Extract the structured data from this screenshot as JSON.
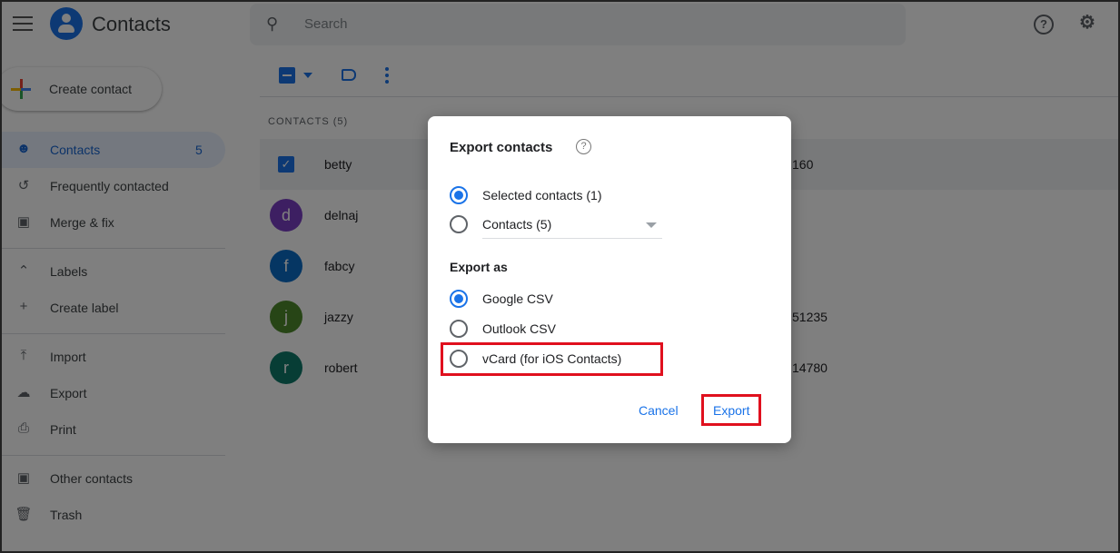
{
  "header": {
    "app_title": "Contacts",
    "search_placeholder": "Search",
    "help_icon": "?",
    "settings_icon": "⚙"
  },
  "sidebar": {
    "create_label": "Create contact",
    "items": [
      {
        "label": "Contacts",
        "count": "5",
        "icon": "person"
      },
      {
        "label": "Frequently contacted",
        "icon": "history"
      },
      {
        "label": "Merge & fix",
        "icon": "merge"
      },
      {
        "label": "Labels",
        "icon": "chevron-up"
      },
      {
        "label": "Create label",
        "icon": "plus"
      },
      {
        "label": "Import",
        "icon": "upload"
      },
      {
        "label": "Export",
        "icon": "cloud-download"
      },
      {
        "label": "Print",
        "icon": "printer"
      },
      {
        "label": "Other contacts",
        "icon": "archive"
      },
      {
        "label": "Trash",
        "icon": "trash"
      }
    ]
  },
  "list": {
    "header": "CONTACTS (5)",
    "rows": [
      {
        "name": "betty",
        "initial": "",
        "phone": "160",
        "color": "#1a73e8"
      },
      {
        "name": "delnaj",
        "initial": "d",
        "phone": "",
        "color": "#7b3fc4"
      },
      {
        "name": "fabcy",
        "initial": "f",
        "phone": "",
        "color": "#0a6cc7"
      },
      {
        "name": "jazzy",
        "initial": "j",
        "phone": "51235",
        "color": "#4f8a2c"
      },
      {
        "name": "robert",
        "initial": "r",
        "phone": "14780",
        "color": "#0e7a6b"
      }
    ]
  },
  "dialog": {
    "title": "Export contacts",
    "selected_option": "Selected contacts (1)",
    "contacts_option": "Contacts (5)",
    "export_as": "Export as",
    "formats": [
      "Google CSV",
      "Outlook CSV",
      "vCard (for iOS Contacts)"
    ],
    "selected_format": "Google CSV",
    "cancel": "Cancel",
    "export": "Export"
  },
  "colors": {
    "accent": "#1a73e8",
    "highlight": "#e0101e"
  }
}
